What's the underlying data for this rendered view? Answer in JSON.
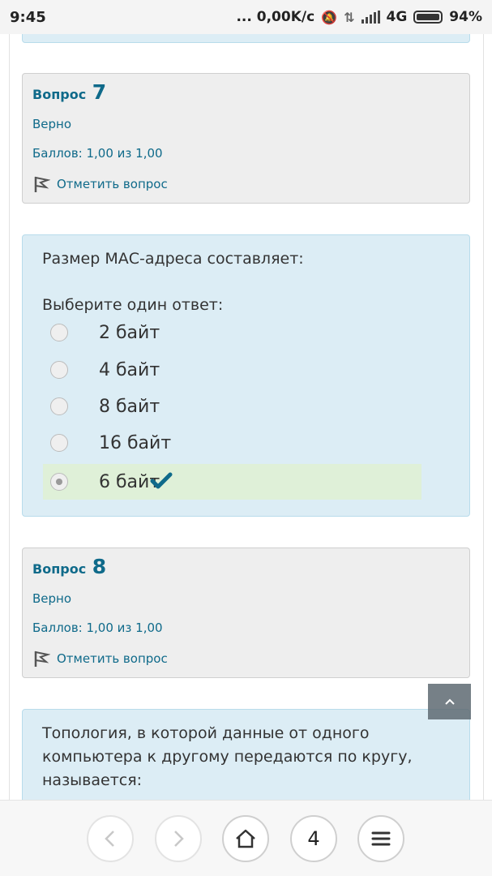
{
  "status": {
    "time": "9:45",
    "speed": "... 0,00K/c",
    "network": "4G",
    "battery": "94%"
  },
  "questions": [
    {
      "label": "Вопрос",
      "number": "7",
      "state": "Верно",
      "grade": "Баллов: 1,00 из 1,00",
      "flag": "Отметить вопрос"
    },
    {
      "label": "Вопрос",
      "number": "8",
      "state": "Верно",
      "grade": "Баллов: 1,00 из 1,00",
      "flag": "Отметить вопрос"
    }
  ],
  "q7": {
    "text": "Размер МАС-адреса составляет:",
    "prompt": "Выберите один ответ:",
    "choices": [
      "2 байт",
      "4 байт",
      "8 байт",
      "16 байт",
      "6 байт"
    ],
    "selected_index": 4
  },
  "q8": {
    "text_lines": [
      "Топология, в которой данные от одного",
      "компьютера к другому передаются по кругу,",
      "называется:"
    ]
  },
  "nav": {
    "tab_count": "4"
  },
  "colors": {
    "accent": "#0f6a8a",
    "correct_bg": "#dff0d8",
    "question_bg": "#dcedf5"
  }
}
